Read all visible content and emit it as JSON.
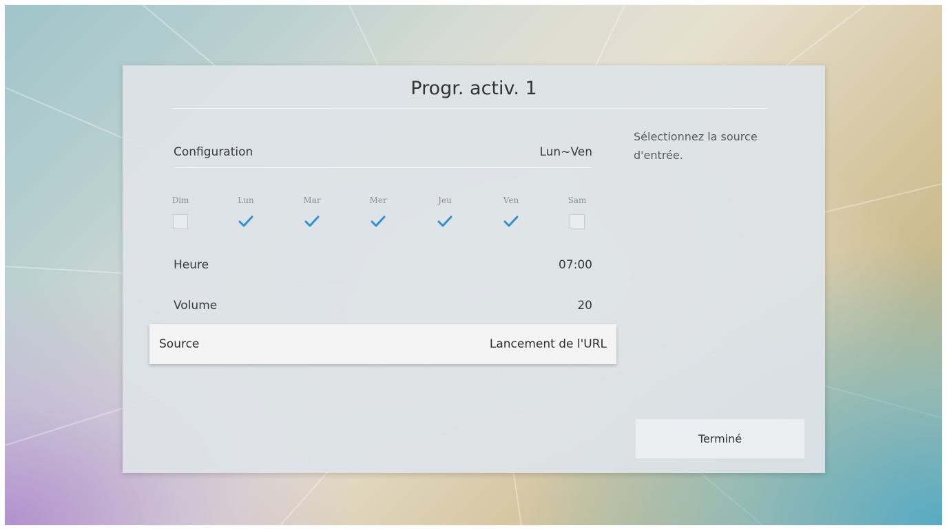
{
  "dialog": {
    "title": "Progr. activ. 1"
  },
  "configuration": {
    "label": "Configuration",
    "value": "Lun~Ven"
  },
  "days": [
    {
      "label": "Dim",
      "checked": false
    },
    {
      "label": "Lun",
      "checked": true
    },
    {
      "label": "Mar",
      "checked": true
    },
    {
      "label": "Mer",
      "checked": true
    },
    {
      "label": "Jeu",
      "checked": true
    },
    {
      "label": "Ven",
      "checked": true
    },
    {
      "label": "Sam",
      "checked": false
    }
  ],
  "heure": {
    "label": "Heure",
    "value": "07:00"
  },
  "volume": {
    "label": "Volume",
    "value": "20"
  },
  "source": {
    "label": "Source",
    "value": "Lancement de l'URL"
  },
  "help": {
    "text": "Sélectionnez la source d'entrée."
  },
  "done_button": {
    "label": "Terminé"
  },
  "colors": {
    "check": "#2f8fd6",
    "dialog_bg": "#dee3e7",
    "selected_row_bg": "#f4f4f4"
  }
}
